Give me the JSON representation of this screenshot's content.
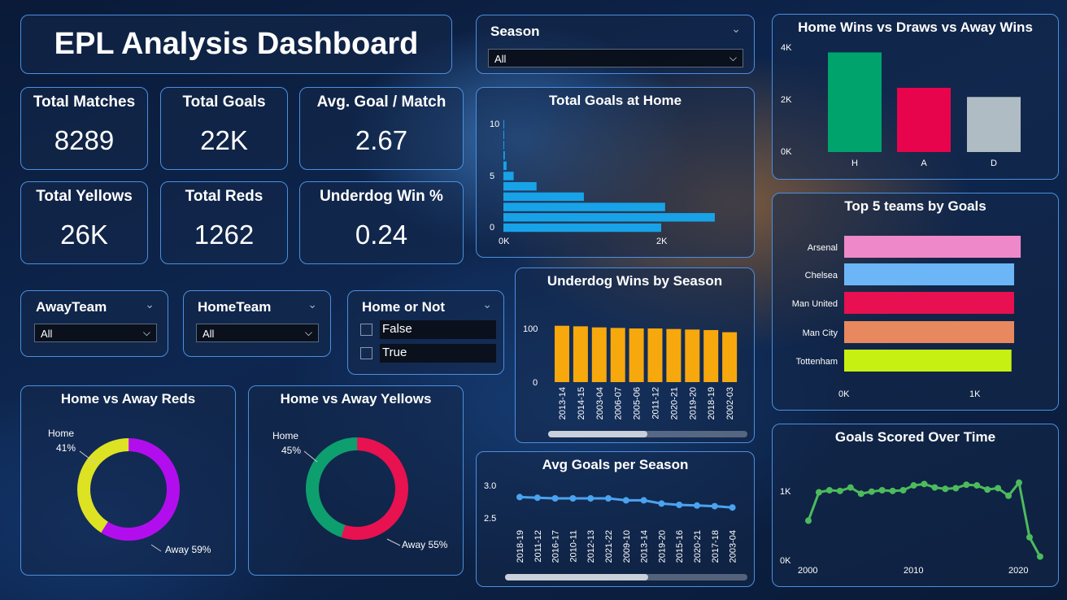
{
  "title": "EPL Analysis Dashboard",
  "kpis": {
    "total_matches": {
      "label": "Total Matches",
      "value": "8289"
    },
    "total_goals": {
      "label": "Total Goals",
      "value": "22K"
    },
    "avg_goal": {
      "label": "Avg. Goal / Match",
      "value": "2.67"
    },
    "total_yellows": {
      "label": "Total Yellows",
      "value": "26K"
    },
    "total_reds": {
      "label": "Total Reds",
      "value": "1262"
    },
    "underdog": {
      "label": "Underdog Win %",
      "value": "0.24"
    }
  },
  "slicers": {
    "season": {
      "label": "Season",
      "value": "All"
    },
    "away_team": {
      "label": "AwayTeam",
      "value": "All"
    },
    "home_team": {
      "label": "HomeTeam",
      "value": "All"
    },
    "home_or_not": {
      "label": "Home or Not",
      "options": [
        "False",
        "True"
      ]
    }
  },
  "colors": {
    "home_win": "#00a36c",
    "away_win": "#e8044c",
    "draw": "#b0bcc4",
    "goals_home": "#18a3e8",
    "underdog": "#f7a80c",
    "avg_line": "#4aa3f0",
    "time_line": "#4cbb5c",
    "reds_home": "#dde223",
    "reds_away": "#b20eed",
    "yellows_home": "#0e9f6e",
    "yellows_away": "#e81250",
    "teams": [
      "#ef88c8",
      "#6cb6f8",
      "#e81050",
      "#e8885e",
      "#c6f012"
    ]
  },
  "charts": {
    "goals_home": {
      "title": "Total Goals at Home"
    },
    "results": {
      "title": "Home Wins vs Draws vs Away Wins"
    },
    "top5": {
      "title": "Top 5 teams by Goals"
    },
    "underdog": {
      "title": "Underdog Wins by Season"
    },
    "avg_season": {
      "title": "Avg Goals per Season"
    },
    "over_time": {
      "title": "Goals Scored Over Time"
    },
    "reds": {
      "title": "Home vs Away Reds",
      "home_label": "Home",
      "home_pct": "41%",
      "away_label": "Away 59%"
    },
    "yellows": {
      "title": "Home vs Away Yellows",
      "home_label": "Home",
      "home_pct": "45%",
      "away_label": "Away 55%"
    }
  },
  "chart_data": [
    {
      "id": "goals_home",
      "type": "bar",
      "orientation": "horizontal",
      "title": "Total Goals at Home",
      "y_ticks": [
        "0",
        "5",
        "10"
      ],
      "x_ticks": [
        "0K",
        "2K"
      ],
      "ylim": [
        0,
        10
      ],
      "xlim": [
        0,
        2000
      ],
      "categories": [
        0,
        1,
        2,
        3,
        4,
        5,
        6,
        7,
        8,
        9,
        10
      ],
      "values": [
        2000,
        2680,
        2050,
        1020,
        420,
        130,
        40,
        18,
        10,
        5,
        3
      ]
    },
    {
      "id": "results",
      "type": "bar",
      "title": "Home Wins vs Draws vs Away Wins",
      "categories": [
        "H",
        "A",
        "D"
      ],
      "values": [
        3800,
        2450,
        2100
      ],
      "y_ticks": [
        "0K",
        "2K",
        "4K"
      ],
      "ylim": [
        0,
        4000
      ]
    },
    {
      "id": "top5",
      "type": "bar",
      "orientation": "horizontal",
      "title": "Top 5 teams by Goals",
      "categories": [
        "Arsenal",
        "Chelsea",
        "Man United",
        "Man City",
        "Tottenham"
      ],
      "values": [
        1340,
        1290,
        1290,
        1290,
        1270
      ],
      "x_ticks": [
        "0K",
        "1K"
      ],
      "xlim": [
        0,
        1000
      ]
    },
    {
      "id": "underdog",
      "type": "bar",
      "title": "Underdog Wins by Season",
      "categories": [
        "2013-14",
        "2014-15",
        "2003-04",
        "2006-07",
        "2005-06",
        "2011-12",
        "2020-21",
        "2019-20",
        "2018-19",
        "2002-03"
      ],
      "values": [
        105,
        104,
        102,
        101,
        100,
        100,
        99,
        98,
        97,
        93
      ],
      "y_ticks": [
        "0",
        "100"
      ],
      "ylim": [
        0,
        100
      ]
    },
    {
      "id": "avg_season",
      "type": "line",
      "title": "Avg Goals per Season",
      "categories": [
        "2018-19",
        "2011-12",
        "2016-17",
        "2010-11",
        "2012-13",
        "2021-22",
        "2009-10",
        "2013-14",
        "2019-20",
        "2015-16",
        "2020-21",
        "2017-18",
        "2003-04"
      ],
      "values": [
        2.82,
        2.81,
        2.8,
        2.8,
        2.8,
        2.8,
        2.77,
        2.77,
        2.72,
        2.7,
        2.69,
        2.68,
        2.66
      ],
      "y_ticks": [
        "2.5",
        "3.0"
      ],
      "ylim": [
        2.5,
        3.0
      ]
    },
    {
      "id": "over_time",
      "type": "line",
      "title": "Goals Scored Over Time",
      "x": [
        2000,
        2001,
        2002,
        2003,
        2004,
        2005,
        2006,
        2007,
        2008,
        2009,
        2010,
        2011,
        2012,
        2013,
        2014,
        2015,
        2016,
        2017,
        2018,
        2019,
        2020,
        2021,
        2022
      ],
      "values": [
        560,
        970,
        1000,
        990,
        1040,
        950,
        980,
        1000,
        990,
        1000,
        1070,
        1090,
        1040,
        1020,
        1030,
        1080,
        1070,
        1010,
        1030,
        920,
        1110,
        320,
        40
      ],
      "x_ticks": [
        "2000",
        "2010",
        "2020"
      ],
      "y_ticks": [
        "0K",
        "1K"
      ],
      "ylim": [
        0,
        1000
      ]
    },
    {
      "id": "reds",
      "type": "pie",
      "title": "Home vs Away Reds",
      "labels": [
        "Home",
        "Away"
      ],
      "values": [
        41,
        59
      ]
    },
    {
      "id": "yellows",
      "type": "pie",
      "title": "Home vs Away Yellows",
      "labels": [
        "Home",
        "Away"
      ],
      "values": [
        45,
        55
      ]
    }
  ]
}
